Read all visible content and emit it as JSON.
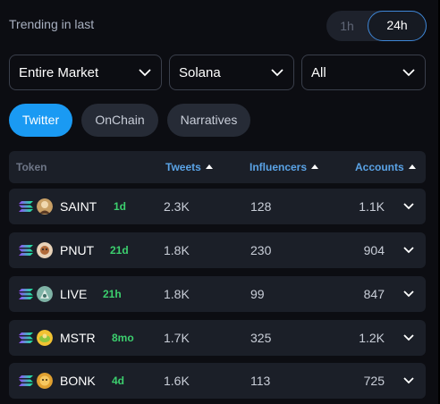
{
  "header": {
    "title": "Trending in last"
  },
  "time_toggle": {
    "options": [
      "1h",
      "24h"
    ],
    "selected": "24h"
  },
  "filters": {
    "market": "Entire Market",
    "chain": "Solana",
    "scope": "All"
  },
  "tabs": [
    {
      "label": "Twitter",
      "active": true
    },
    {
      "label": "OnChain",
      "active": false
    },
    {
      "label": "Narratives",
      "active": false
    }
  ],
  "table": {
    "columns": {
      "token": "Token",
      "tweets": "Tweets",
      "influencers": "Influencers",
      "accounts": "Accounts"
    },
    "rows": [
      {
        "symbol": "SAINT",
        "age": "1d",
        "tweets": "2.3K",
        "influencers": "128",
        "accounts": "1.1K",
        "avatar_color": "#c9a066"
      },
      {
        "symbol": "PNUT",
        "age": "21d",
        "tweets": "1.8K",
        "influencers": "230",
        "accounts": "904",
        "avatar_color": "#d89a5e"
      },
      {
        "symbol": "LIVE",
        "age": "21h",
        "tweets": "1.8K",
        "influencers": "99",
        "accounts": "847",
        "avatar_color": "#7fb3a6"
      },
      {
        "symbol": "MSTR",
        "age": "8mo",
        "tweets": "1.7K",
        "influencers": "325",
        "accounts": "1.2K",
        "avatar_color": "#f1c232"
      },
      {
        "symbol": "BONK",
        "age": "4d",
        "tweets": "1.6K",
        "influencers": "113",
        "accounts": "725",
        "avatar_color": "#e0a030"
      }
    ]
  },
  "colors": {
    "accent": "#1a9af3",
    "age_green": "#3ccf6e",
    "row_bg": "#1b1f28",
    "panel_bg": "#0c0d12"
  },
  "icons": {
    "chain": "solana-icon",
    "dropdown": "chevron-down-icon",
    "expand": "chevron-down-icon",
    "sort": "sort-up-icon"
  }
}
